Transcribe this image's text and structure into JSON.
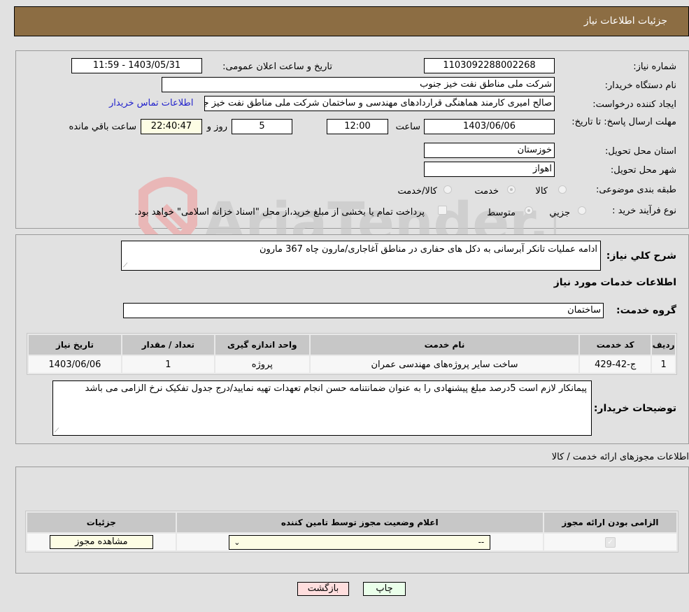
{
  "header": {
    "title": "جزئیات اطلاعات نیاز"
  },
  "form": {
    "need_number_label": "شماره نیاز:",
    "need_number": "1103092288002268",
    "announce_label": "تاریخ و ساعت اعلان عمومی:",
    "announce_value": "1403/05/31 - 11:59",
    "buyer_org_label": "نام دستگاه خریدار:",
    "buyer_org": "شرکت ملی مناطق نفت خیز جنوب",
    "creator_label": "ایجاد کننده درخواست:",
    "creator": "صالح امیری کارمند هماهنگی قراردادهای مهندسی و ساختمان شرکت ملی مناطق نفت خیز جنوب",
    "contact_link": "اطلاعات تماس خریدار",
    "deadline_label": "مهلت ارسال پاسخ: تا تاریخ:",
    "deadline_date": "1403/06/06",
    "time_label": "ساعت",
    "deadline_time": "12:00",
    "days_value": "5",
    "days_label": "روز و",
    "remaining_time": "22:40:47",
    "remaining_label": "ساعت باقي مانده",
    "province_label": "استان محل تحویل:",
    "province": "خوزستان",
    "city_label": "شهر محل تحویل:",
    "city": "اهواز",
    "category_label": "طبقه بندی موضوعی:",
    "category_options": [
      {
        "label": "کالا",
        "checked": false
      },
      {
        "label": "خدمت",
        "checked": true
      },
      {
        "label": "کالا/خدمت",
        "checked": false
      }
    ],
    "process_label": "نوع فرآیند خرید :",
    "process_options": [
      {
        "label": "جزيي",
        "checked": false
      },
      {
        "label": "متوسط",
        "checked": true
      }
    ],
    "treasury_note": "پرداخت تمام یا بخشی از مبلغ خرید،از محل \"اسناد خزانه اسلامی\" خواهد بود."
  },
  "details": {
    "general_desc_label": "شرح كلي نياز:",
    "general_desc": "ادامه عملیات تانکر آبرسانی به دکل های حفاری در مناطق آغاجاری/مارون چاه 367 مارون",
    "services_heading": "اطلاعات خدمات مورد نیاز",
    "service_group_label": "گروه خدمت:",
    "service_group": "ساختمان",
    "table": {
      "headers": [
        "ردیف",
        "کد خدمت",
        "نام خدمت",
        "واحد اندازه گیری",
        "تعداد / مقدار",
        "تاریخ نیاز"
      ],
      "rows": [
        [
          "1",
          "ج-42-429",
          "ساخت سایر پروژه‌های مهندسی عمران",
          "پروژه",
          "1",
          "1403/06/06"
        ]
      ]
    },
    "buyer_notes_label": "توضیحات خریدار:",
    "buyer_notes": "پیمانکار لازم است 5درصد مبلغ پیشنهادی را به عنوان ضمانتنامه حسن انجام تعهدات تهیه نمایید/درج جدول تفکیک نرخ الزامی می باشد"
  },
  "licenses": {
    "heading": "اطلاعات مجوزهای ارائه خدمت / کالا",
    "headers": [
      "الزامی بودن ارائه مجوز",
      "اعلام وضعیت مجوز توسط تامین کننده",
      "جزئیات"
    ],
    "row": {
      "required_checked": true,
      "status_selected": "--",
      "view_button": "مشاهده مجوز"
    }
  },
  "footer": {
    "print_button": "چاپ",
    "back_button": "بازگشت"
  },
  "watermark": {
    "text": "AriaTender.neT"
  },
  "colors": {
    "header_bg": "#8c6d43",
    "print_bg": "#eaffea",
    "back_bg": "#ffdede",
    "link": "#2222cc"
  }
}
